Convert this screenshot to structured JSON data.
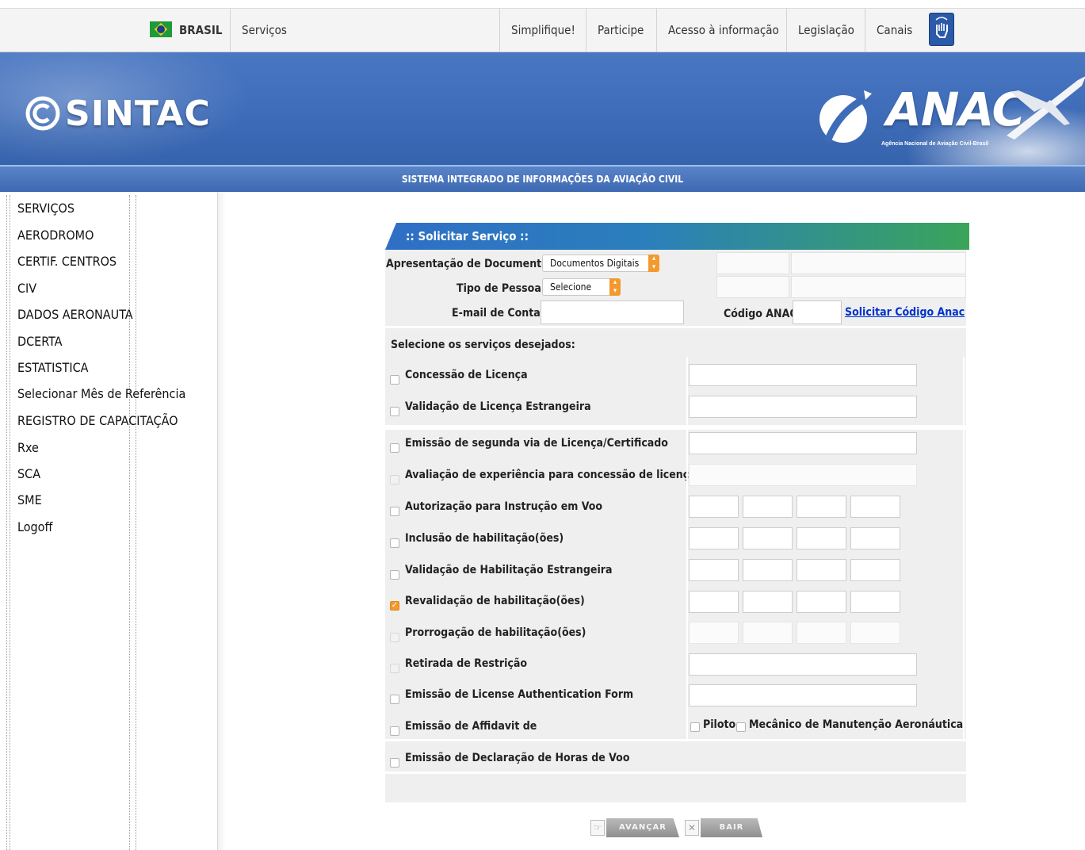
{
  "gov_bar": {
    "country": "BRASIL",
    "links": [
      "Serviços",
      "Simplifique!",
      "Participe",
      "Acesso à informação",
      "Legislação",
      "Canais"
    ]
  },
  "header": {
    "logo_left": "SINTAC",
    "logo_right": "ANAC",
    "logo_right_subtitle": "Agência Nacional de Aviação Civil-Brasil",
    "system_name": "SISTEMA INTEGRADO DE INFORMAÇÕES DA AVIAÇÃO CIVIL"
  },
  "sidebar": {
    "items": [
      "SERVIÇOS",
      "AERODROMO",
      "CERTIF. CENTROS",
      "CIV",
      "DADOS AERONAUTA",
      "DCERTA",
      "ESTATISTICA",
      "Selecionar Mês de Referência",
      "REGISTRO DE CAPACITAÇÃO",
      "Rxe",
      "SCA",
      "SME",
      "Logoff"
    ]
  },
  "form": {
    "title": ":: Solicitar Serviço ::",
    "apresentacao_label": "Apresentação de Documentos:*",
    "apresentacao_value": "Documentos Digitais",
    "tipo_pessoa_label": "Tipo de Pessoa:*",
    "tipo_pessoa_value": "Selecione",
    "email_label": "E-mail de Contato",
    "email_value": "",
    "codigo_label": "Código ANAC:",
    "codigo_value": "",
    "solicitar_codigo_link": "Solicitar Código Anac",
    "services_header": "Selecione os serviços desejados:",
    "services": [
      {
        "label": "Concessão de Licença",
        "checked": false,
        "enabled": true
      },
      {
        "label": "Validação de Licença Estrangeira",
        "checked": false,
        "enabled": true
      },
      {
        "label": "Emissão de segunda via de Licença/Certificado",
        "checked": false,
        "enabled": true
      },
      {
        "label": "Avaliação de experiência para concessão de licença",
        "checked": false,
        "enabled": false
      },
      {
        "label": "Autorização para Instrução em Voo",
        "checked": false,
        "enabled": true
      },
      {
        "label": "Inclusão de habilitação(ões)",
        "checked": false,
        "enabled": true
      },
      {
        "label": "Validação de Habilitação Estrangeira",
        "checked": false,
        "enabled": true
      },
      {
        "label": "Revalidação de habilitação(ões)",
        "checked": true,
        "enabled": true
      },
      {
        "label": "Prorrogação de habilitação(ões)",
        "checked": false,
        "enabled": false
      },
      {
        "label": "Retirada de Restrição",
        "checked": false,
        "enabled": false
      },
      {
        "label": "Emissão de License Authentication Form",
        "checked": false,
        "enabled": true
      },
      {
        "label": "Emissão de Affidavit de",
        "checked": false,
        "enabled": true
      },
      {
        "label": "Emissão de Declaração de Horas de Voo",
        "checked": false,
        "enabled": true
      }
    ],
    "affidavit_options": [
      "Piloto",
      "Mecânico de Manutenção Aeronáutica"
    ]
  },
  "buttons": {
    "next": "AVANÇAR",
    "exit": "BAIR"
  },
  "colors": {
    "header_blue": "#3e6cb8",
    "accent_orange": "#f29a2e",
    "link_blue": "#0033cc",
    "title_green": "#3aa45a"
  }
}
